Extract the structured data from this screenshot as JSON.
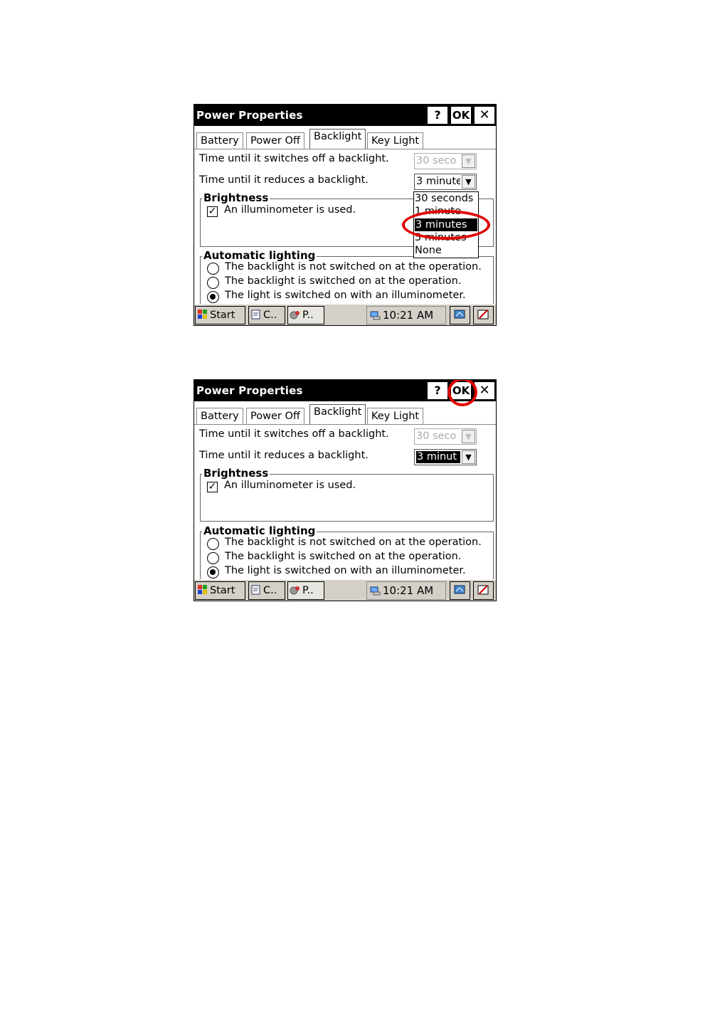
{
  "screens": [
    {
      "window_title": "Power Properties",
      "title_buttons": {
        "help": "?",
        "ok": "OK",
        "close": "✕"
      },
      "tabs": [
        "Battery",
        "Power Off",
        "Backlight",
        "Key Light"
      ],
      "active_tab": "Backlight",
      "switch_off_label": "Time until it switches off a backlight.",
      "switch_off_value": "30 seco",
      "reduce_label": "Time until it reduces a backlight.",
      "reduce_value": "3 minute",
      "brightness": {
        "title": "Brightness",
        "checkbox_label": "An illuminometer is used.",
        "checked": true
      },
      "auto_lighting": {
        "title": "Automatic lighting",
        "options": [
          "The backlight is not switched on at the operation.",
          "The backlight is switched on at the operation.",
          "The light is switched on with an illuminometer."
        ],
        "selected_index": 2
      },
      "dropdown_options": [
        "30 seconds",
        "1 minute",
        "3 minutes",
        "5 minutes",
        "None"
      ],
      "dropdown_selected_index": 2,
      "taskbar": {
        "start": "Start",
        "task1": "C..",
        "task2": "P..",
        "clock": "10:21 AM"
      }
    },
    {
      "window_title": "Power Properties",
      "title_buttons": {
        "help": "?",
        "ok": "OK",
        "close": "✕"
      },
      "tabs": [
        "Battery",
        "Power Off",
        "Backlight",
        "Key Light"
      ],
      "active_tab": "Backlight",
      "switch_off_label": "Time until it switches off a backlight.",
      "switch_off_value": "30 seco",
      "reduce_label": "Time until it reduces a backlight.",
      "reduce_value": "3 minut",
      "brightness": {
        "title": "Brightness",
        "checkbox_label": "An illuminometer is used.",
        "checked": true
      },
      "auto_lighting": {
        "title": "Automatic lighting",
        "options": [
          "The backlight is not switched on at the operation.",
          "The backlight is switched on at the operation.",
          "The light is switched on with an illuminometer."
        ],
        "selected_index": 2
      },
      "taskbar": {
        "start": "Start",
        "task1": "C..",
        "task2": "P..",
        "clock": "10:21 AM"
      }
    }
  ],
  "annotation_color": "#e00000"
}
